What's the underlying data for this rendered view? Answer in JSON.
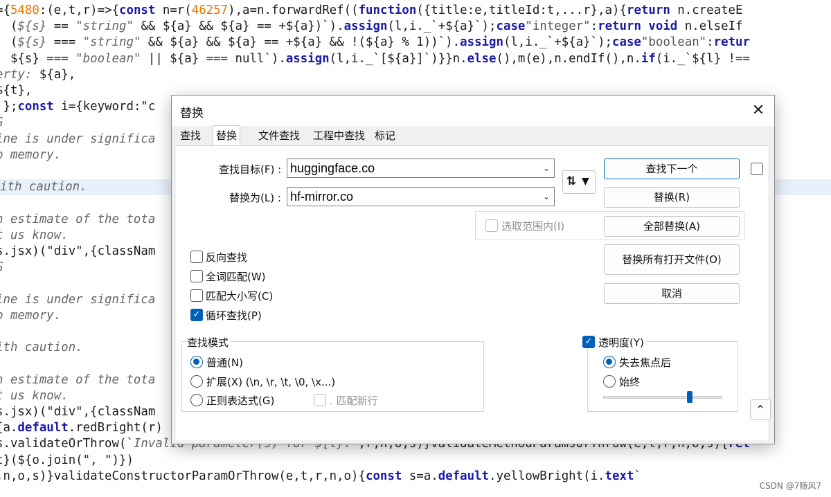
{
  "editor": {
    "lines": [
      [
        {
          "t": "={"
        },
        {
          "t": "5480",
          "c": "c-num"
        },
        {
          "t": ":(e,t,r)=>{"
        },
        {
          "t": "const",
          "c": "c-kw"
        },
        {
          "t": " n=r("
        },
        {
          "t": "46257",
          "c": "c-num"
        },
        {
          "t": "),a=n.forwardRef(("
        },
        {
          "t": "function",
          "c": "c-kw"
        },
        {
          "t": "({title:e,titleId:t,...r},a){"
        },
        {
          "t": "return",
          "c": "c-kw"
        },
        {
          "t": " n.createE"
        }
      ],
      [
        {
          "t": "| ("
        },
        {
          "t": "${s}",
          "c": "c-em"
        },
        {
          "t": " == "
        },
        {
          "t": "\"string\"",
          "c": "c-em"
        },
        {
          "t": " && ${a} && ${a} == +${a})`)."
        },
        {
          "t": "assign",
          "c": "c-kw"
        },
        {
          "t": "(l,i._`+${a}`);"
        },
        {
          "t": "case",
          "c": "c-kw"
        },
        {
          "t": "\"integer\"",
          "c": "c-str"
        },
        {
          "t": ":"
        },
        {
          "t": "return void",
          "c": "c-kw"
        },
        {
          "t": " n.elseIf"
        }
      ],
      [
        {
          "t": "| ("
        },
        {
          "t": "${s}",
          "c": "c-em"
        },
        {
          "t": " === "
        },
        {
          "t": "\"string\"",
          "c": "c-em"
        },
        {
          "t": " && ${a} && ${a} == +${a} && !(${a} % 1))`)."
        },
        {
          "t": "assign",
          "c": "c-kw"
        },
        {
          "t": "(l,i._`+${a}`);"
        },
        {
          "t": "case",
          "c": "c-kw"
        },
        {
          "t": "\"boolean\"",
          "c": "c-str"
        },
        {
          "t": ":"
        },
        {
          "t": "retur",
          "c": "c-kw"
        }
      ],
      [
        {
          "t": "| ${s} === "
        },
        {
          "t": "\"boolean\"",
          "c": "c-em"
        },
        {
          "t": " || ${a} === null`)."
        },
        {
          "t": "assign",
          "c": "c-kw"
        },
        {
          "t": "(l,i._`[${a}]`)}}n."
        },
        {
          "t": "else",
          "c": "c-kw"
        },
        {
          "t": "(),m(e),n.endIf(),n."
        },
        {
          "t": "if",
          "c": "c-kw"
        },
        {
          "t": "(i._`${l} !=="
        }
      ],
      [
        {
          "t": "erty:",
          "c": "c-em"
        },
        {
          "t": " ${a},"
        }
      ],
      [
        {
          "t": "${t},"
        }
      ],
      [
        {
          "t": "`};"
        },
        {
          "t": "const",
          "c": "c-kw"
        },
        {
          "t": " i={keyword:\"c                                                        [t,r]=fu"
        }
      ],
      [
        {
          "t": "G",
          "c": "c-em"
        }
      ],
      [
        {
          "t": "ine is under significa",
          "c": "c-em"
        }
      ],
      [
        {
          "t": "p memory.",
          "c": "c-em"
        }
      ],
      [
        {
          "t": ""
        }
      ],
      [
        {
          "t": "ith caution.",
          "c": "c-em"
        }
      ],
      [
        {
          "t": ""
        }
      ],
      [
        {
          "t": "n estimate of the tota",
          "c": "c-em"
        }
      ],
      [
        {
          "t": "t us know.",
          "c": "c-em"
        }
      ],
      [
        {
          "t": "s.jsx)(\"div\",{classNam                                                             `),chil"
        }
      ],
      [
        {
          "t": "G",
          "c": "c-em"
        }
      ],
      [
        {
          "t": ""
        }
      ],
      [
        {
          "t": "ine is under significa",
          "c": "c-em"
        }
      ],
      [
        {
          "t": "p memory.",
          "c": "c-em"
        }
      ],
      [
        {
          "t": ""
        }
      ],
      [
        {
          "t": "ith caution.",
          "c": "c-em"
        }
      ],
      [
        {
          "t": ""
        }
      ],
      [
        {
          "t": "n estimate of the tota",
          "c": "c-em"
        }
      ],
      [
        {
          "t": "t us know.",
          "c": "c-em"
        }
      ],
      [
        {
          "t": "s.jsx)(\"div\",{classNam                                                             `),chil"
        }
      ],
      [
        {
          "t": "{a."
        },
        {
          "t": "default",
          "c": "c-kw"
        },
        {
          "t": ".redBright(r)"
        }
      ],
      [
        {
          "t": "s.validateOrThrow(`"
        },
        {
          "t": "Invalid parameter(s) for ${l}:",
          "c": "c-em"
        },
        {
          "t": "`,r,n,o,s)}validateMethodParamsOrThrow(e,t,r,n,o,s){"
        },
        {
          "t": "ret",
          "c": "c-kw"
        }
      ],
      [
        {
          "t": "t}(${o.join(\", \")})"
        }
      ],
      [
        {
          "t": ",n,o,s)}validateConstructorParamOrThrow(e,t,r,n,o){"
        },
        {
          "t": "const",
          "c": "c-kw"
        },
        {
          "t": " s=a."
        },
        {
          "t": "default",
          "c": "c-kw"
        },
        {
          "t": ".yellowBright(i."
        },
        {
          "t": "text",
          "c": "c-kw"
        },
        {
          "t": "`"
        }
      ]
    ]
  },
  "watermark": "CSDN @7随风7",
  "dialog": {
    "title": "替换",
    "tabs": [
      "查找",
      "替换",
      "文件查找",
      "工程中查找",
      "标记"
    ],
    "active_tab": "替换",
    "find_label": "查找目标(F) :",
    "find_value": "huggingface.co",
    "replace_label": "替换为(L) :",
    "replace_value": "hf-mirror.co",
    "swap_icon": "swap-arrows-icon",
    "buttons": {
      "find_next": "查找下一个",
      "replace": "替换(R)",
      "replace_all": "全部替换(A)",
      "replace_all_open": "替换所有打开文件(O)",
      "cancel": "取消"
    },
    "in_selection": "选取范围内(I)",
    "options": [
      {
        "label": "反向查找",
        "checked": false
      },
      {
        "label": "全词匹配(W)",
        "checked": false
      },
      {
        "label": "匹配大小写(C)",
        "checked": false
      },
      {
        "label": "循环查找(P)",
        "checked": true
      }
    ],
    "search_mode": {
      "title": "查找模式",
      "normal": "普通(N)",
      "extended": "扩展(X) (\\n, \\r, \\t, \\0, \\x...)",
      "regex": "正则表达式(G)",
      "dot_newline": ". 匹配新行",
      "selected": "普通(N)"
    },
    "transparency": {
      "label": "透明度(Y)",
      "enabled": true,
      "on_lose_focus": "失去焦点后",
      "always": "始终",
      "selected": "失去焦点后",
      "level": 0.85
    },
    "collapse_icon": "caret-up-icon",
    "accent_color": "#005fb8"
  }
}
